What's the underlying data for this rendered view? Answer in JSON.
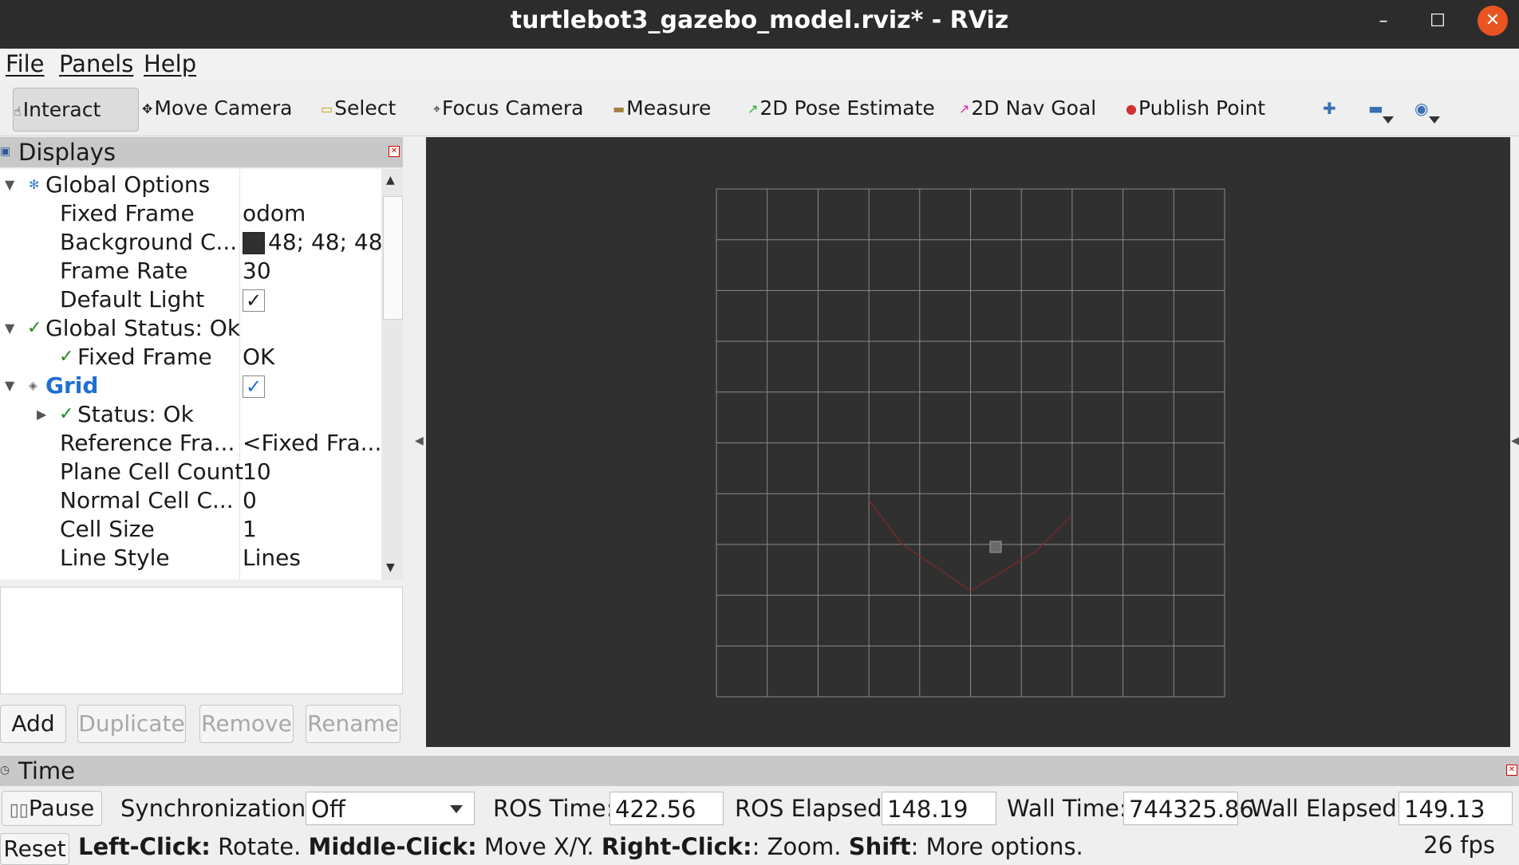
{
  "window": {
    "title": "turtlebot3_gazebo_model.rviz* - RViz",
    "minimize": "–",
    "maximize": "☐",
    "close": "✕"
  },
  "menu": {
    "file": "File",
    "panels": "Panels",
    "help": "Help"
  },
  "toolbar": {
    "interact": "Interact",
    "move_camera": "Move Camera",
    "select": "Select",
    "focus_camera": "Focus Camera",
    "measure": "Measure",
    "pose_estimate": "2D Pose Estimate",
    "nav_goal": "2D Nav Goal",
    "publish_point": "Publish Point",
    "accent_pose": "#22aa22",
    "accent_goal": "#dd22aa",
    "accent_point": "#cc3333"
  },
  "displays": {
    "title": "Displays",
    "rows": [
      {
        "key": "Global Options"
      },
      {
        "key": "Fixed Frame",
        "value": "odom"
      },
      {
        "key": "Background C...",
        "value": "48; 48; 48"
      },
      {
        "key": "Frame Rate",
        "value": "30"
      },
      {
        "key": "Default Light",
        "value": "✓"
      },
      {
        "key": "Global Status: Ok"
      },
      {
        "key": "Fixed Frame",
        "value": "OK"
      },
      {
        "key": "Grid",
        "value": "✓"
      },
      {
        "key": "Status: Ok"
      },
      {
        "key": "Reference Fra...",
        "value": "<Fixed Fra..."
      },
      {
        "key": "Plane Cell Count",
        "value": "10"
      },
      {
        "key": "Normal Cell C...",
        "value": "0"
      },
      {
        "key": "Cell Size",
        "value": "1"
      },
      {
        "key": "Line Style",
        "value": "Lines"
      }
    ],
    "background_color": "#303030",
    "grid_color": "#1f6fd1",
    "buttons": {
      "add": "Add",
      "duplicate": "Duplicate",
      "remove": "Remove",
      "rename": "Rename"
    }
  },
  "time": {
    "title": "Time",
    "pause": "Pause",
    "sync_label": "Synchronization:",
    "sync_value": "Off",
    "ros_time_label": "ROS Time:",
    "ros_time": "422.56",
    "ros_elapsed_label": "ROS Elapsed:",
    "ros_elapsed": "148.19",
    "wall_time_label": "Wall Time:",
    "wall_time": "744325.86",
    "wall_elapsed_label": "Wall Elapsed:",
    "wall_elapsed": "149.13"
  },
  "status": {
    "reset": "Reset",
    "lc_label": "Left-Click:",
    "lc_text": " Rotate. ",
    "mc_label": "Middle-Click:",
    "mc_text": " Move X/Y. ",
    "rc_label": "Right-Click:",
    "rc_text": ": Zoom. ",
    "sh_label": "Shift",
    "sh_text": ": More options.",
    "fps": "26 fps"
  }
}
